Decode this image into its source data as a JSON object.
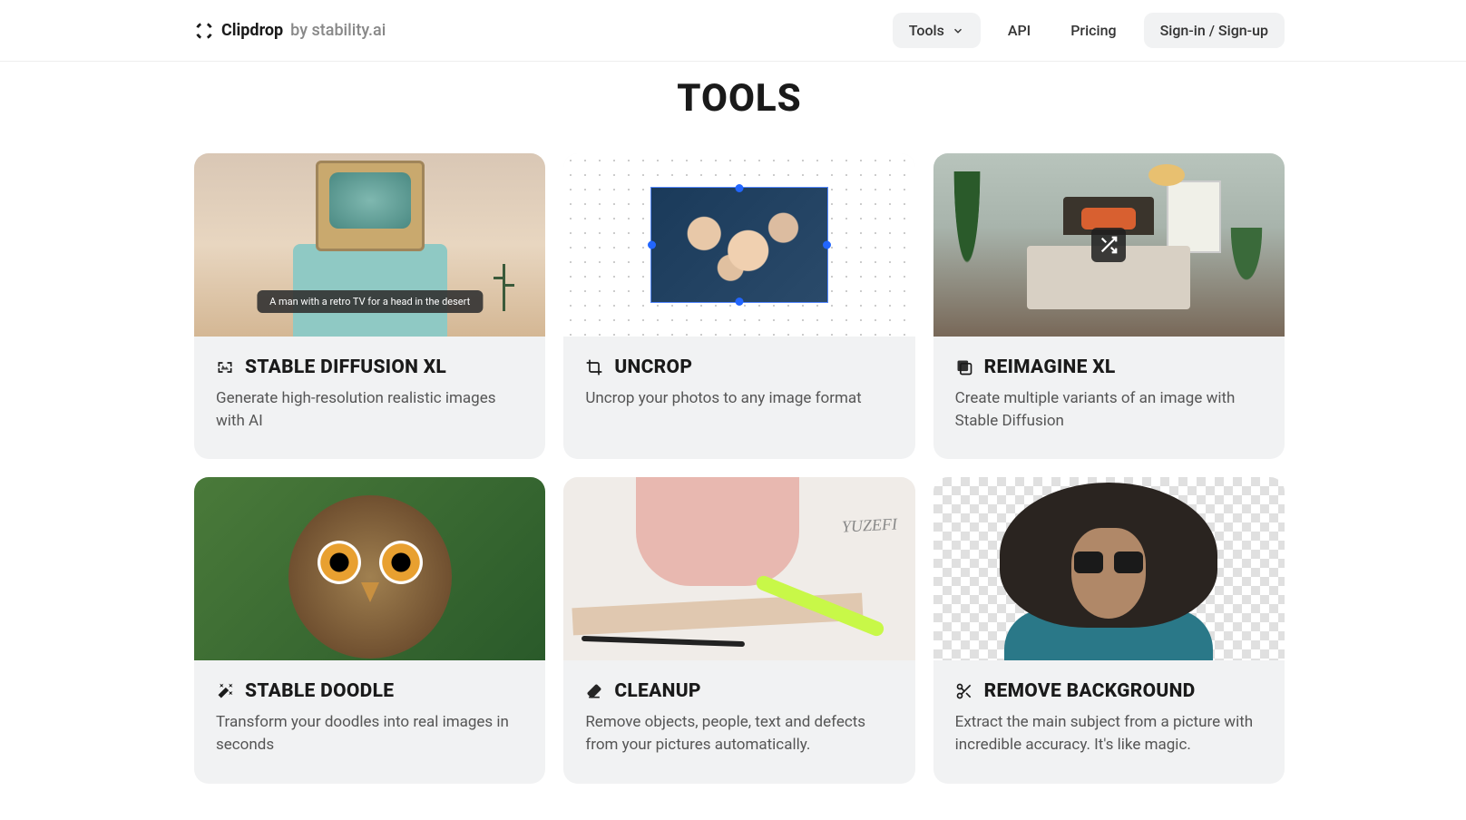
{
  "header": {
    "brand": "Clipdrop",
    "brand_suffix": "by stability.ai",
    "nav": {
      "tools": "Tools",
      "api": "API",
      "pricing": "Pricing",
      "signin": "Sign-in / Sign-up"
    }
  },
  "section_title": "TOOLS",
  "cards": [
    {
      "title": "STABLE DIFFUSION XL",
      "desc": "Generate high-resolution realistic images with AI",
      "image_caption": "A man with a retro TV for a head in the desert"
    },
    {
      "title": "UNCROP",
      "desc": "Uncrop your photos to any image format"
    },
    {
      "title": "REIMAGINE XL",
      "desc": "Create multiple variants of an image with Stable Diffusion"
    },
    {
      "title": "STABLE DOODLE",
      "desc": "Transform your doodles into real images in seconds"
    },
    {
      "title": "CLEANUP",
      "desc": "Remove objects, people, text and defects from your pictures automatically.",
      "paper_text": "YUZEFI"
    },
    {
      "title": "REMOVE BACKGROUND",
      "desc": "Extract the main subject from a picture with incredible accuracy. It's like magic."
    }
  ]
}
